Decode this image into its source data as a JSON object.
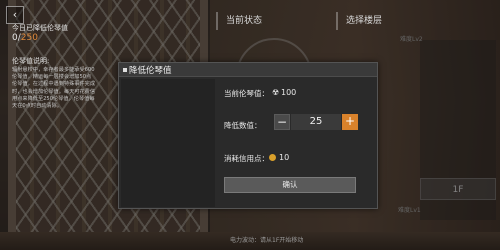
{
  "hud": {
    "back_icon": "back-arrow-icon",
    "tab_status": "当前状态",
    "tab_floor": "选择楼层",
    "difficulty_top": "难度Lv2",
    "difficulty_bottom": "难度Lv1",
    "floor_1f": "1F",
    "bottom_hint": "电力波动：请从1F开始移动"
  },
  "modal": {
    "title": "降低伦琴值",
    "today_label": "今日已降低伦琴值",
    "today_value": "0/",
    "today_limit": "250",
    "explain_title": "伦琴值说明:",
    "explain_text": "辐射悬校中，幸存者最多能承受600伦琴值，精运每一层楼会增加50点伦琴值，在过程中遇到特殊事件完成时，也会增加伦琴值。每天可花费信用点来降低至250伦琴值，伦琴值每天在0点时自动清除。",
    "current_label": "当前伦琴值：",
    "current_value": "100",
    "radiation_icon": "☢",
    "reduce_label": "降低数值：",
    "stepper_value": "25",
    "minus_label": "−",
    "plus_label": "+",
    "cost_label": "消耗信用点：",
    "cost_value": "10",
    "confirm_label": "确认"
  },
  "colors": {
    "accent": "#d9822b",
    "limit_text": "#e08a3c",
    "coin": "#d9a02b"
  }
}
